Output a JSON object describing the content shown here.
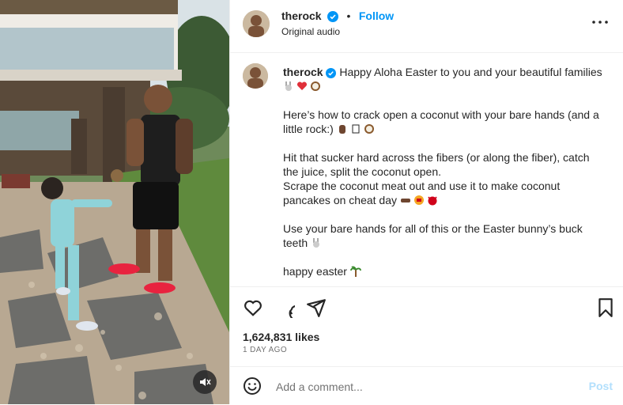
{
  "post": {
    "author": "therock",
    "audio": "Original audio",
    "follow_label": "Follow",
    "separator": "•",
    "caption": {
      "username": "therock",
      "line1": "Happy Aloha Easter to you and your beautiful families",
      "p2": "Here’s how to crack open a coconut with your bare hands (and a little rock:)",
      "p3a": "Hit that sucker hard across the fibers (or along the fiber), catch the juice, split the coconut open.",
      "p3b": "Scrape the coconut meat out and use it to make coconut pancakes on cheat day",
      "p4": "Use your bare hands for all of this or the Easter bunny’s buck teeth",
      "p5": "happy easter"
    },
    "likes": "1,624,831 likes",
    "time": "1 DAY AGO"
  },
  "comment": {
    "placeholder": "Add a comment...",
    "post_label": "Post"
  },
  "colors": {
    "accent": "#0095f6",
    "verified": "#0095f6",
    "post_disabled": "#b2dffc",
    "text": "#262626",
    "muted": "#737373"
  },
  "icons": [
    "verified-badge-icon",
    "more-options-icon",
    "heart-icon",
    "comment-icon",
    "share-icon",
    "bookmark-icon",
    "emoji-icon",
    "mute-icon"
  ]
}
